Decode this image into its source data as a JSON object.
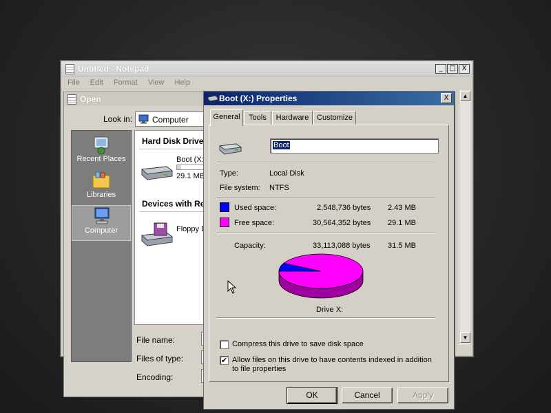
{
  "notepad": {
    "title": "Untitled - Notepad",
    "menu": [
      "File",
      "Edit",
      "Format",
      "View",
      "Help"
    ],
    "caption_buttons": {
      "minimize": "_",
      "maximize": "□",
      "close": "X"
    }
  },
  "open_dialog": {
    "title": "Open",
    "look_in_label": "Look in:",
    "look_in_value": "Computer",
    "places": [
      {
        "label": "Recent Places",
        "icon": "recent-places-icon"
      },
      {
        "label": "Libraries",
        "icon": "libraries-icon"
      },
      {
        "label": "Computer",
        "icon": "computer-icon"
      }
    ],
    "groups": {
      "hard_disk": "Hard Disk Drive",
      "removable": "Devices with Re"
    },
    "drives": {
      "boot_name": "Boot (X:",
      "boot_free": "29.1 MB",
      "floppy_name": "Floppy D"
    },
    "fields": {
      "file_name": "File name:",
      "files_of_type": "Files of type:",
      "encoding": "Encoding:"
    }
  },
  "properties": {
    "title": "Boot (X:) Properties",
    "close": "X",
    "tabs": [
      "General",
      "Tools",
      "Hardware",
      "Customize"
    ],
    "name_value": "Boot",
    "type_label": "Type:",
    "type_value": "Local Disk",
    "fs_label": "File system:",
    "fs_value": "NTFS",
    "used_label": "Used space:",
    "used_bytes": "2,548,736 bytes",
    "used_size": "2.43 MB",
    "free_label": "Free space:",
    "free_bytes": "30,564,352 bytes",
    "free_size": "29.1 MB",
    "capacity_label": "Capacity:",
    "capacity_bytes": "33,113,088 bytes",
    "capacity_size": "31.5 MB",
    "drive_label": "Drive X:",
    "compress_label": "Compress this drive to save disk space",
    "compress_checked": false,
    "index_label_line1": "Allow files on this drive to have contents indexed in addition",
    "index_label_line2": "to file properties",
    "index_checked": true,
    "check_mark": "✔",
    "buttons": {
      "ok": "OK",
      "cancel": "Cancel",
      "apply": "Apply"
    },
    "colors": {
      "used": "#0000ff",
      "free": "#ff00ff"
    },
    "used_fraction": 0.077
  }
}
